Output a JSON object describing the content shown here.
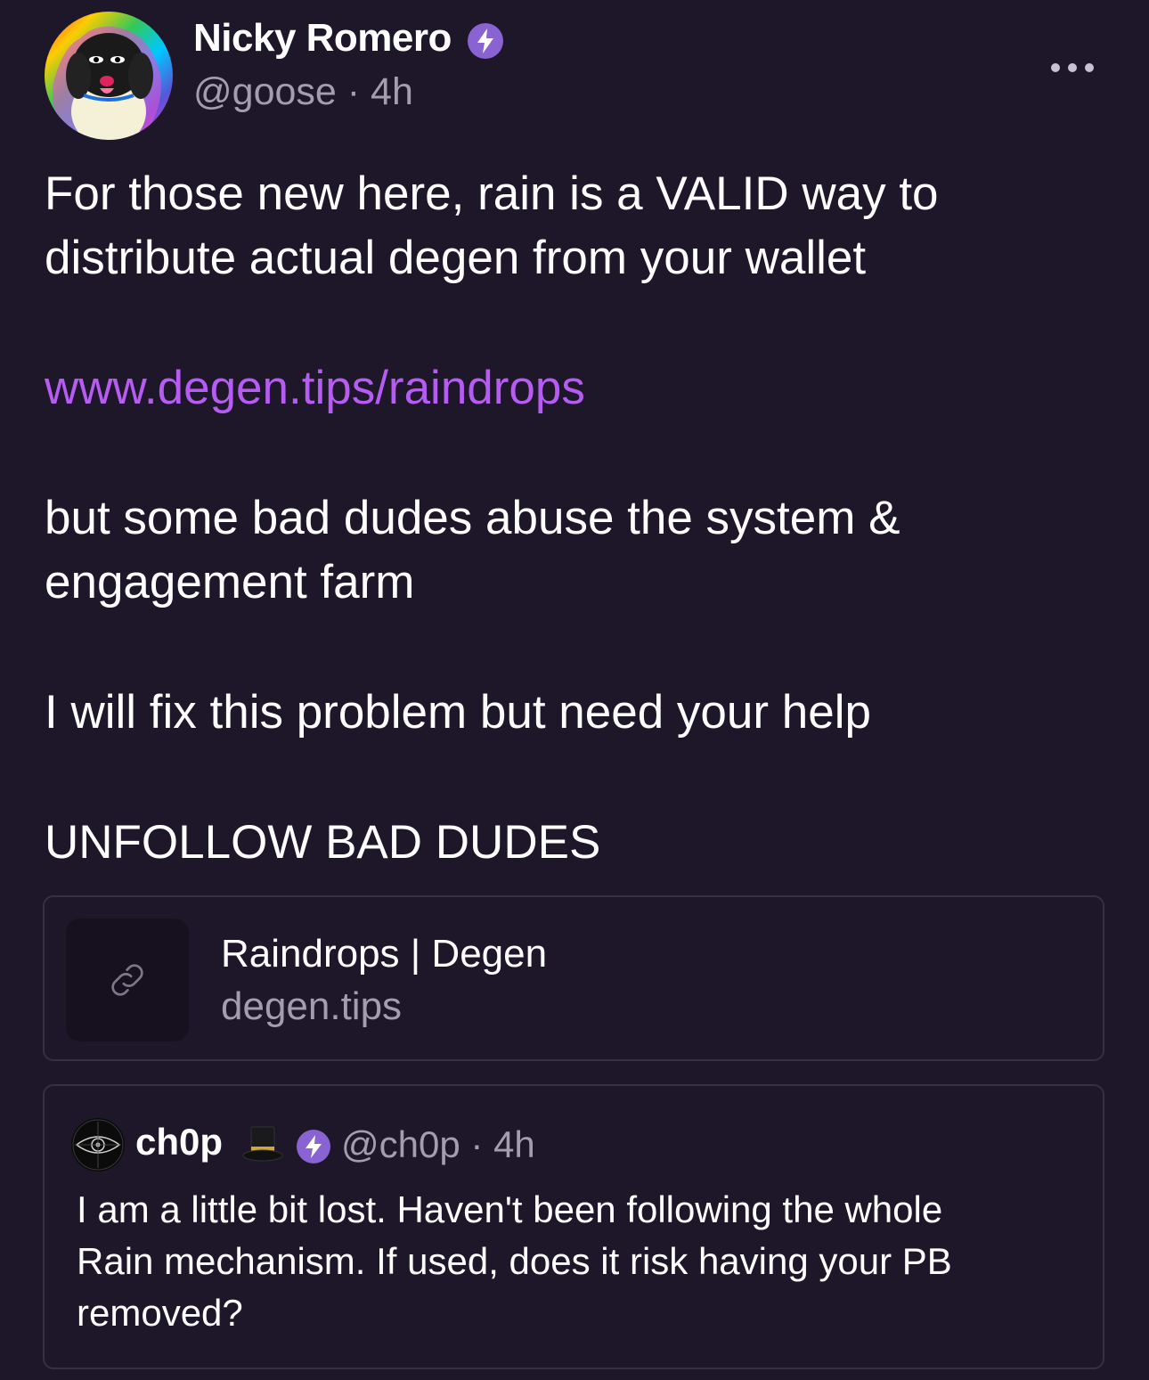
{
  "post": {
    "author": {
      "display_name": "Nicky Romero",
      "handle": "@goose",
      "separator": "·",
      "time": "4h",
      "verified_icon": "power-badge-icon"
    },
    "more_icon": "ellipsis-icon",
    "body_lines": {
      "line1": "For those new here, rain is a VALID way to",
      "line2": "distribute actual degen from your wallet",
      "link": "www.degen.tips/raindrops",
      "line3": "but some bad dudes abuse the system &",
      "line4": "engagement farm",
      "line5": "I will fix this problem but need your help",
      "line6": "UNFOLLOW BAD DUDES"
    },
    "embed": {
      "title": "Raindrops | Degen",
      "domain": "degen.tips",
      "icon": "link-icon"
    },
    "quote": {
      "display_name": "ch0p",
      "emoji_icon": "top-hat-icon",
      "handle": "@ch0p",
      "separator": "·",
      "time": "4h",
      "text_lines": {
        "line1": "I am a little bit lost. Haven't been following the whole",
        "line2": "Rain mechanism. If used, does it risk having your PB",
        "line3": "removed?"
      }
    },
    "colors": {
      "background": "#1e1629",
      "accent_link": "#b65cf2",
      "badge": "#8a63d2",
      "muted_text": "#a29daf",
      "card_border": "#372f44"
    }
  }
}
